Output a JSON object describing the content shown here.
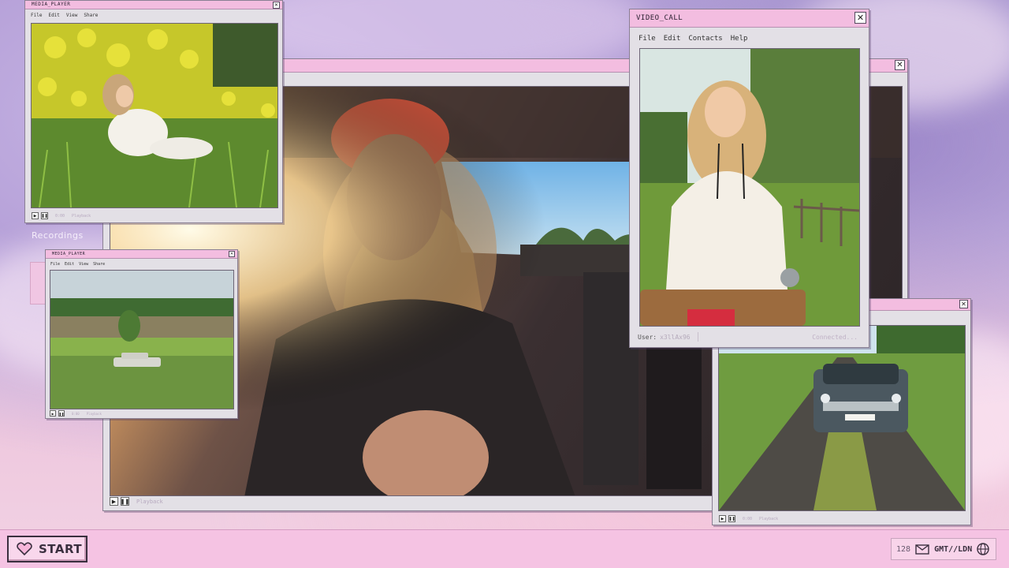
{
  "desktop": {
    "recordings_label": "Recordings"
  },
  "windows": {
    "media_player_top": {
      "title": "MEDIA_PLAYER",
      "menu": [
        "File",
        "Edit",
        "View",
        "Share"
      ],
      "controls": {
        "time": "0:00",
        "status": "Playback"
      }
    },
    "media_player_small": {
      "title": "MEDIA_PLAYER",
      "menu": [
        "File",
        "Edit",
        "View",
        "Share"
      ],
      "controls": {
        "time": "0:00",
        "status": "Playback"
      }
    },
    "main_player": {
      "controls": {
        "status": "Playback"
      }
    },
    "video_call": {
      "title": "VIDEO_CALL",
      "menu": [
        "File",
        "Edit",
        "Contacts",
        "Help"
      ],
      "footer": {
        "user_label": "User:",
        "user_value": "x3llAx96",
        "status": "Connected..."
      }
    },
    "road_player": {
      "controls": {
        "time": "0:00",
        "status": "Playback"
      }
    }
  },
  "taskbar": {
    "start_label": "START",
    "tray": {
      "count": "128",
      "clock": "GMT//LDN"
    }
  },
  "icons": [
    "heart-icon",
    "close-icon",
    "play-icon",
    "pause-icon",
    "mail-icon",
    "globe-icon"
  ],
  "colors": {
    "titlebar": "#f3bde0",
    "taskbar": "#f5c3e3",
    "window": "#e3e0e6"
  }
}
